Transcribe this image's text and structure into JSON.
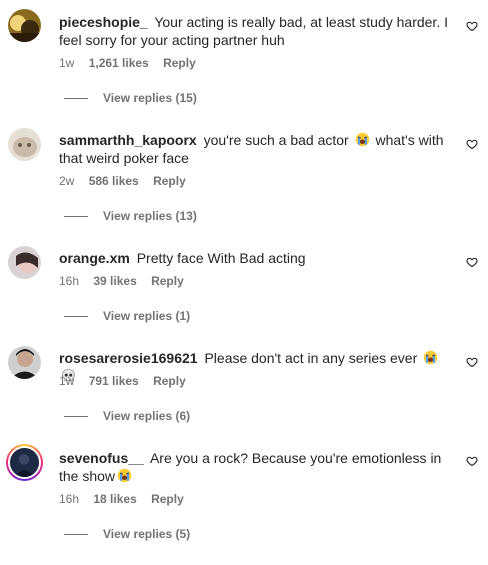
{
  "comments": [
    {
      "username": "pieceshopie_",
      "text": "Your acting is really bad, at least study harder. I feel sorry for your acting partner huh",
      "time": "1w",
      "likes": "1,261 likes",
      "reply_label": "Reply",
      "view_replies": "View replies (15)",
      "avatar_icon": "avatar-photo-icon"
    },
    {
      "username": "sammarthh_kapoorx",
      "text_before": "you're such a bad actor",
      "text_after": "what's with that weird poker face",
      "emoji": "crying-face-icon",
      "time": "2w",
      "likes": "586 likes",
      "reply_label": "Reply",
      "view_replies": "View replies (13)",
      "avatar_icon": "avatar-photo-icon"
    },
    {
      "username": "orange.xm",
      "text": "Pretty face With Bad acting",
      "time": "16h",
      "likes": "39 likes",
      "reply_label": "Reply",
      "view_replies": "View replies (1)",
      "avatar_icon": "avatar-photo-icon"
    },
    {
      "username": "rosesarerosie169621",
      "text": "Please don't act in any series ever",
      "emojis": [
        "crying-face-icon",
        "skull-icon"
      ],
      "time": "1w",
      "likes": "791 likes",
      "reply_label": "Reply",
      "view_replies": "View replies (6)",
      "avatar_icon": "avatar-photo-icon"
    },
    {
      "username": "sevenofus__",
      "text": "Are you a rock? Because you're emotionless in the show",
      "emoji": "crying-face-icon",
      "time": "16h",
      "likes": "18 likes",
      "reply_label": "Reply",
      "view_replies": "View replies (5)",
      "avatar_icon": "avatar-photo-icon",
      "has_story_ring": true
    }
  ],
  "colors": {
    "text": "#262626",
    "secondary": "#737373",
    "background": "#ffffff"
  },
  "icons": {
    "like": "heart-outline-icon"
  }
}
